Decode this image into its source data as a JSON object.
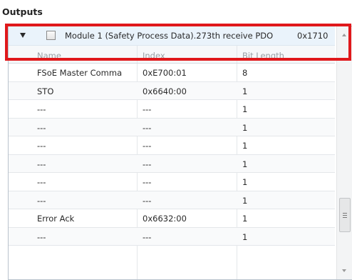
{
  "section_title": "Outputs",
  "group": {
    "label": "Module 1 (Safety Process Data).273th receive PDO",
    "code": "0x1710",
    "checked": false,
    "expanded": true
  },
  "columns": {
    "name": "Name",
    "index": "Index",
    "bit_length": "Bit Length"
  },
  "rows": [
    {
      "name": "FSoE Master Comma",
      "index": "0xE700:01",
      "bits": "8"
    },
    {
      "name": "STO",
      "index": "0x6640:00",
      "bits": "1"
    },
    {
      "name": "---",
      "index": "---",
      "bits": "1"
    },
    {
      "name": "---",
      "index": "---",
      "bits": "1"
    },
    {
      "name": "---",
      "index": "---",
      "bits": "1"
    },
    {
      "name": "---",
      "index": "---",
      "bits": "1"
    },
    {
      "name": "---",
      "index": "---",
      "bits": "1"
    },
    {
      "name": "---",
      "index": "---",
      "bits": "1"
    },
    {
      "name": "Error Ack",
      "index": "0x6632:00",
      "bits": "1"
    },
    {
      "name": "---",
      "index": "---",
      "bits": "1"
    }
  ],
  "colors": {
    "highlight": "#e0181b",
    "group_row_bg": "#eaf3fb",
    "header_text": "#9aa0a6"
  }
}
